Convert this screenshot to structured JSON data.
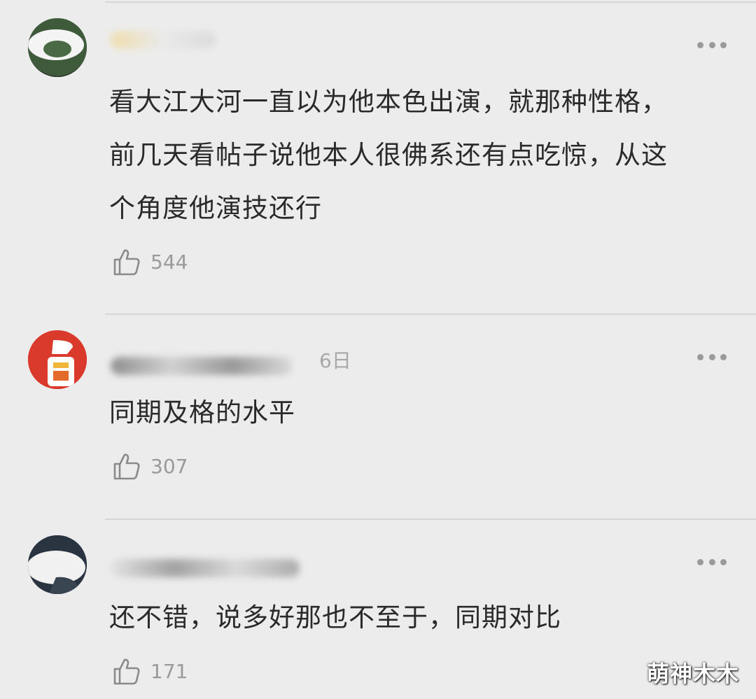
{
  "comments": [
    {
      "text_lines": [
        "看大江大河一直以为他本色出演，就那种性格，",
        "前几天看帖子说他本人很佛系还有点吃惊，从这",
        "个角度他演技还行"
      ],
      "time": "",
      "likes": "544",
      "avatar_colors": [
        "#3e5a3a",
        "#ffffff"
      ]
    },
    {
      "text_lines": [
        "同期及格的水平"
      ],
      "time": "6日",
      "likes": "307",
      "avatar_colors": [
        "#d93a2b",
        "#ffffff"
      ]
    },
    {
      "text_lines": [
        "还不错，说多好那也不至于，同期对比"
      ],
      "time": "",
      "likes": "171",
      "avatar_colors": [
        "#2a3440",
        "#ffffff"
      ]
    }
  ],
  "watermark": "萌神木木",
  "icons": {
    "more": "more-dots-icon",
    "like": "thumbs-up-icon"
  },
  "colors": {
    "background": "#ececec",
    "text": "#2a2a2a",
    "muted": "#9a9a9a"
  }
}
